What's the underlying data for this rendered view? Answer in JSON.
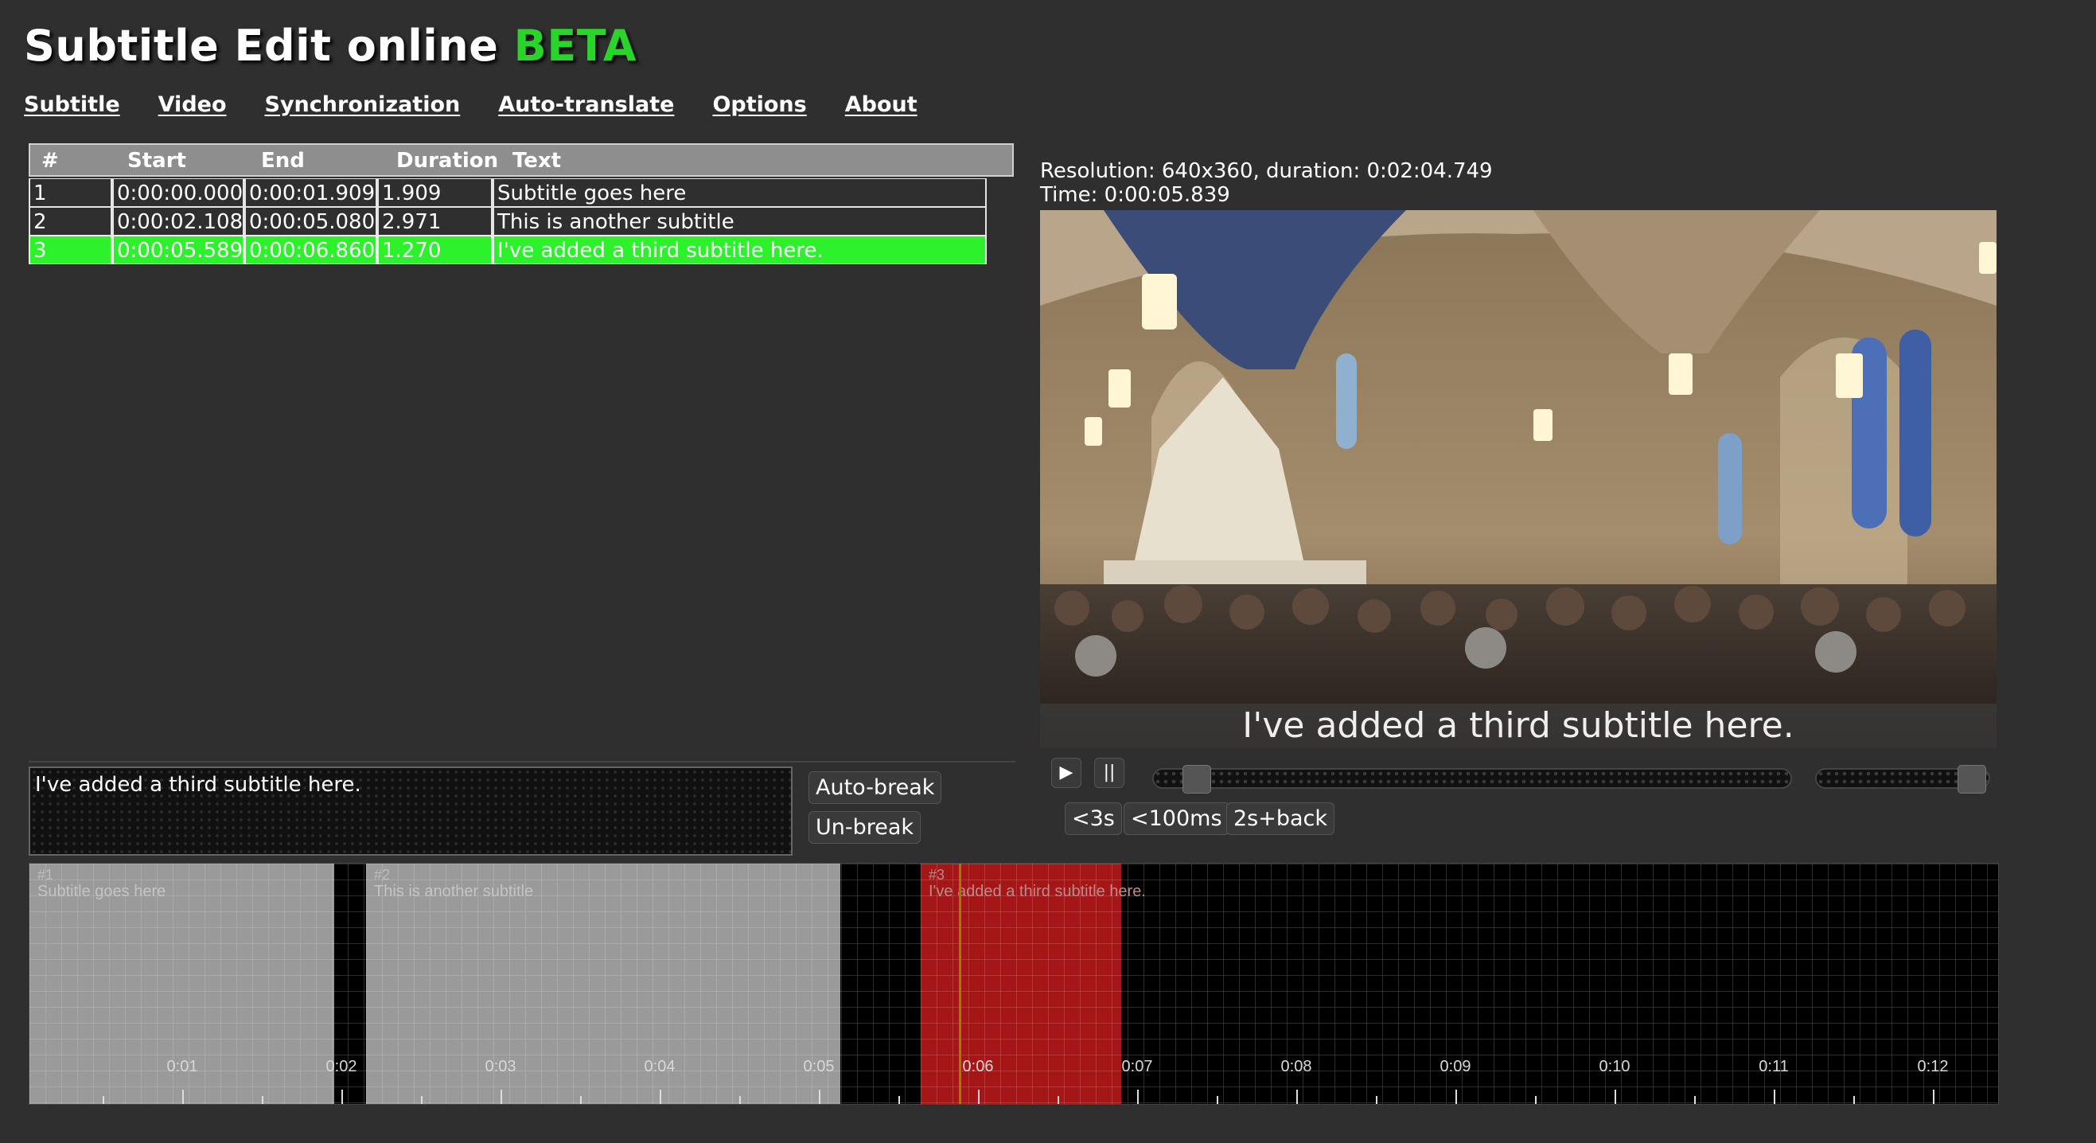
{
  "app": {
    "title": "Subtitle Edit online",
    "title_tag": "BETA"
  },
  "menu": [
    "Subtitle",
    "Video",
    "Synchronization",
    "Auto-translate",
    "Options",
    "About"
  ],
  "grid": {
    "columns": [
      "#",
      "Start",
      "End",
      "Duration",
      "Text"
    ],
    "rows": [
      {
        "num": "1",
        "start": "0:00:00.000",
        "end": "0:00:01.909",
        "duration": "1.909",
        "text": "Subtitle goes here",
        "selected": false
      },
      {
        "num": "2",
        "start": "0:00:02.108",
        "end": "0:00:05.080",
        "duration": "2.971",
        "text": "This is another subtitle",
        "selected": false
      },
      {
        "num": "3",
        "start": "0:00:05.589",
        "end": "0:00:06.860",
        "duration": "1.270",
        "text": "I've added a third subtitle here.",
        "selected": true
      }
    ]
  },
  "editor": {
    "text": "I've added a third subtitle here.",
    "auto_break": "Auto-break",
    "un_break": "Un-break"
  },
  "video": {
    "resolution_line": "Resolution: 640x360, duration: 0:02:04.749",
    "time_line": "Time: 0:00:05.839",
    "subtitle_overlay": "I've added a third subtitle here.",
    "play_icon": "▶",
    "pause_icon": "||",
    "seek_position": 0.047,
    "volume_level": 0.95
  },
  "controls": {
    "back_3s": "<3s",
    "back_100ms": "<100ms",
    "back_2s_play": "2s+back"
  },
  "waveform": {
    "segments": [
      {
        "num": "#1",
        "text": "Subtitle goes here",
        "selected": false
      },
      {
        "num": "#2",
        "text": "This is another subtitle",
        "selected": false
      },
      {
        "num": "#3",
        "text": "I've added a third subtitle here.",
        "selected": true
      }
    ],
    "time_labels": [
      "0:01",
      "0:02",
      "0:03",
      "0:04",
      "0:05",
      "0:06",
      "0:07",
      "0:08",
      "0:09",
      "0:10",
      "0:11",
      "0:12"
    ]
  },
  "colors": {
    "accent_green": "#2ad42a",
    "selection_green": "#2df12d",
    "selected_segment": "#a51616",
    "background": "#2f2f2f"
  }
}
